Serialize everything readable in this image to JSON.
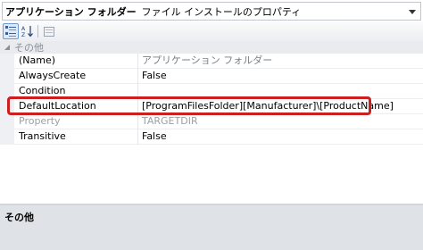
{
  "object_selector": {
    "name": "アプリケーション フォルダー",
    "type": "ファイル インストールのプロパティ"
  },
  "icons": {
    "dropdown": "chevron-down-icon",
    "categorized": "categorized-icon",
    "alphabetical": "sort-alphabetical-icon",
    "property_pages": "property-pages-icon",
    "collapse": "collapse-triangle-icon"
  },
  "category": {
    "label": "その他"
  },
  "properties": [
    {
      "name": "(Name)",
      "value": "アプリケーション フォルダー"
    },
    {
      "name": "AlwaysCreate",
      "value": "False"
    },
    {
      "name": "Condition",
      "value": ""
    },
    {
      "name": "DefaultLocation",
      "value": "[ProgramFilesFolder][Manufacturer]\\[ProductName]"
    },
    {
      "name": "Property",
      "value": "TARGETDIR"
    },
    {
      "name": "Transitive",
      "value": "False"
    }
  ],
  "description": {
    "title": "その他"
  },
  "colors": {
    "highlight": "#cc1f1f",
    "category_bg": "#e9ebef",
    "description_bg": "#dfe3e8",
    "disabled_text": "#9aa0a8"
  }
}
